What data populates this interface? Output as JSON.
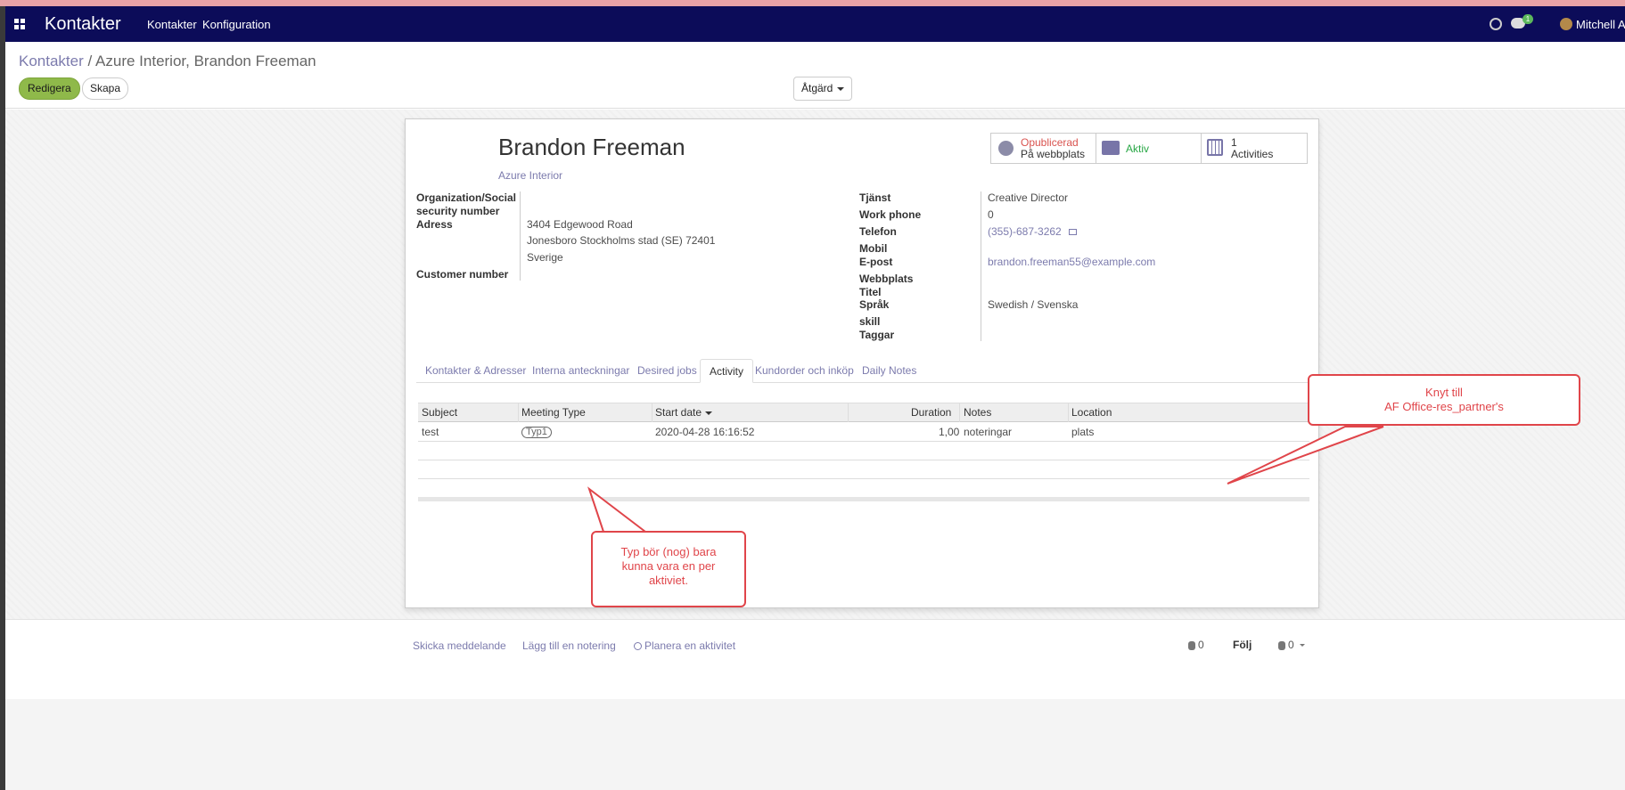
{
  "navbar": {
    "app_title": "Kontakter",
    "menu": [
      "Kontakter",
      "Konfiguration"
    ],
    "chat_badge": "1",
    "user_name": "Mitchell Ad"
  },
  "breadcrumb": {
    "parent": "Kontakter",
    "separator": "/",
    "current": "Azure Interior, Brandon Freeman"
  },
  "buttons": {
    "edit": "Redigera",
    "create": "Skapa",
    "action": "Åtgärd"
  },
  "partner": {
    "name": "Brandon Freeman",
    "company": "Azure Interior"
  },
  "stat_buttons": {
    "website_status": "Opublicerad",
    "website_label": "På webbplats",
    "active_label": "Aktiv",
    "activities_count": "1",
    "activities_label": "Activities"
  },
  "left_fields": {
    "org_label_1": "Organization/Social",
    "org_label_2": "security number",
    "address_label": "Adress",
    "address_street": "3404 Edgewood Road",
    "address_city_line": "Jonesboro  Stockholms stad (SE)  72401",
    "address_country": "Sverige",
    "customer_number_label": "Customer number"
  },
  "right_fields": {
    "job_label": "Tjänst",
    "job_value": "Creative Director",
    "work_phone_label": "Work phone",
    "work_phone_value": "0",
    "phone_label": "Telefon",
    "phone_value": "(355)-687-3262",
    "mobile_label": "Mobil",
    "email_label": "E-post",
    "email_value": "brandon.freeman55@example.com",
    "website_label": "Webbplats",
    "title_label": "Titel",
    "language_label": "Språk",
    "language_value": "Swedish / Svenska",
    "skill_label": "skill",
    "tags_label": "Taggar"
  },
  "tabs": [
    "Kontakter & Adresser",
    "Interna anteckningar",
    "Desired jobs",
    "Activity",
    "Kundorder och inköp",
    "Daily Notes"
  ],
  "activity_table": {
    "columns": [
      "Subject",
      "Meeting Type",
      "Start date",
      "Duration",
      "Notes",
      "Location"
    ],
    "rows": [
      {
        "subject": "test",
        "meeting_type": "Typ1",
        "start_date": "2020-04-28 16:16:52",
        "duration": "1,00",
        "notes": "noteringar",
        "location": "plats"
      }
    ]
  },
  "callouts": {
    "top_right_line1": "Knyt till",
    "top_right_line2": "AF Office-res_partner's",
    "bottom_line1": "Typ bör (nog) bara",
    "bottom_line2": "kunna vara en per",
    "bottom_line3": "aktiviet."
  },
  "chatter": {
    "send_message": "Skicka meddelande",
    "log_note": "Lägg till en notering",
    "schedule_activity": "Planera en aktivitet",
    "attachments_count": "0",
    "follow": "Följ",
    "followers_count": "0"
  },
  "colors": {
    "navbar": "#0c0c59",
    "edit_button": "#8fb94a",
    "link": "#7c7bad",
    "callout": "#e0454a"
  }
}
